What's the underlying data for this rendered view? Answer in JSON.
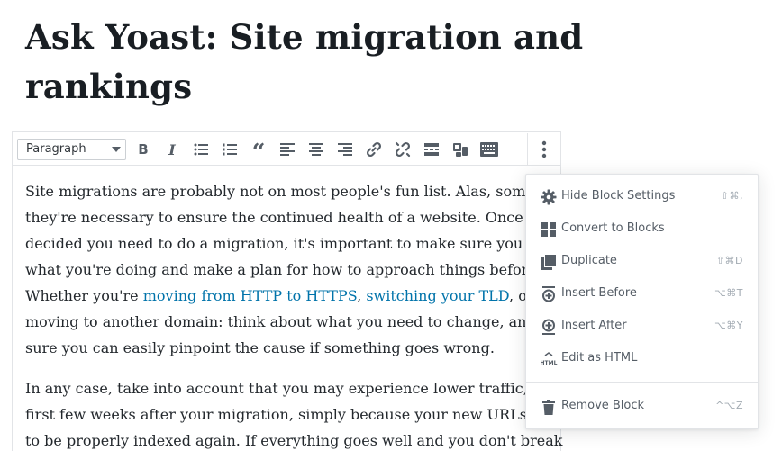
{
  "post": {
    "title_line1": "Ask Yoast: Site migration and",
    "title_line2": "rankings"
  },
  "toolbar": {
    "format_select": "Paragraph",
    "buttons": [
      {
        "name": "bold-icon",
        "glyph": "B"
      },
      {
        "name": "italic-icon",
        "glyph": "I"
      },
      {
        "name": "bullet-list-icon"
      },
      {
        "name": "numbered-list-icon"
      },
      {
        "name": "blockquote-icon",
        "glyph": "“"
      },
      {
        "name": "align-left-icon"
      },
      {
        "name": "align-center-icon"
      },
      {
        "name": "align-right-icon"
      },
      {
        "name": "link-icon"
      },
      {
        "name": "unlink-icon"
      },
      {
        "name": "read-more-icon"
      },
      {
        "name": "toolbar-toggle-icon"
      },
      {
        "name": "keyboard-icon"
      },
      {
        "name": "more-options-icon"
      }
    ]
  },
  "content": {
    "paragraph1": {
      "l1": "Site migrations are probably not on most people's fun list. Alas, sometime",
      "l2": "they're necessary to ensure the continued health of a website. Once you'v",
      "l3": "decided you need to do a migration, it's important to make sure you know",
      "l4": "what you're doing and make a plan for how to approach things beforehan",
      "l5_pre": "Whether you're ",
      "l5_link1": "moving from HTTP to HTTPS",
      "l5_mid": ", ",
      "l5_link2": "switching your TLD",
      "l5_post": ", or",
      "l6": "moving to another domain: think about what you need to change, and ma",
      "l7": "sure you can easily pinpoint the cause if something goes wrong."
    },
    "paragraph2": {
      "l1": "In any case, take into account that you may experience lower traffic, the",
      "l2": "first few weeks after your migration, simply because your new URLs nee",
      "l3": "to be properly indexed again. If everything goes well and you don't break"
    }
  },
  "menu": {
    "items": [
      {
        "label": "Hide Block Settings",
        "shortcut": "⇧⌘,",
        "icon": "gear-icon"
      },
      {
        "label": "Convert to Blocks",
        "shortcut": "",
        "icon": "grid-icon"
      },
      {
        "label": "Duplicate",
        "shortcut": "⇧⌘D",
        "icon": "duplicate-icon"
      },
      {
        "label": "Insert Before",
        "shortcut": "⌥⌘T",
        "icon": "insert-before-icon"
      },
      {
        "label": "Insert After",
        "shortcut": "⌥⌘Y",
        "icon": "insert-after-icon"
      },
      {
        "label": "Edit as HTML",
        "shortcut": "",
        "icon": "html-icon",
        "icon_text": "HTML"
      },
      {
        "label": "Remove Block",
        "shortcut": "^⌥Z",
        "icon": "trash-icon"
      }
    ]
  }
}
